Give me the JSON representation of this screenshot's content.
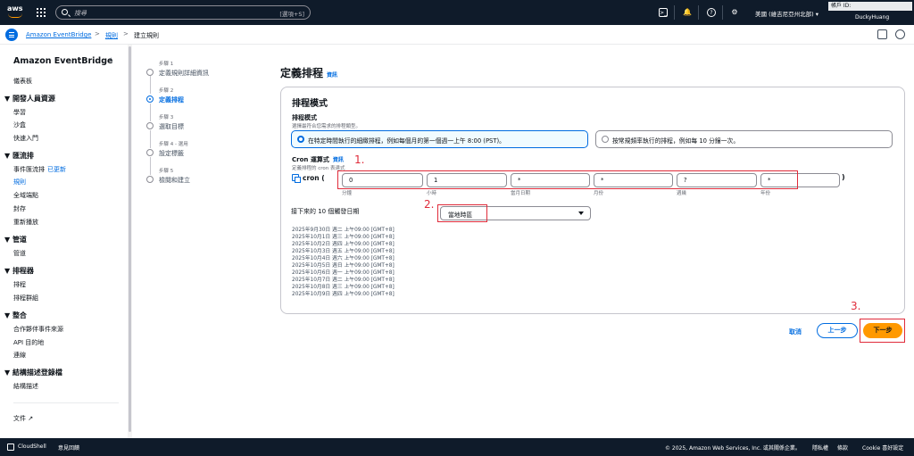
{
  "topnav": {
    "logo_text": "aws",
    "search_placeholder": "搜尋",
    "search_shortcut": "[選項+S]",
    "region": "美國 (維吉尼亞州北部) ▾",
    "account_label": "帳戶 ID:",
    "user": "DuckyHuang"
  },
  "breadcrumb": {
    "service": "Amazon EventBridge",
    "section": "規則",
    "current": "建立規則",
    "sep": ">"
  },
  "sidebar": {
    "title": "Amazon EventBridge",
    "close": "‹",
    "dashboard": "儀表板",
    "dev_resources": "▼ 開發人員資源",
    "learn": "學習",
    "sandbox": "沙盒",
    "quick_start": "快速入門",
    "buses": "▼ 匯流排",
    "event_bus": "事件匯流排",
    "new_badge": "已更新",
    "rules": "規則",
    "global_endpoints": "全域端點",
    "archive": "封存",
    "replay": "重新播放",
    "pipes_head": "▼ 管道",
    "pipes": "管道",
    "scheduler_head": "▼ 排程器",
    "schedules": "排程",
    "schedule_groups": "排程群組",
    "integration_head": "▼ 整合",
    "partner_sources": "合作夥伴事件來源",
    "api_destinations": "API 目的地",
    "connections": "連線",
    "schema_head": "▼ 結構描述登錄檔",
    "schemas": "結構描述",
    "docs": "文件 ↗"
  },
  "steps": [
    {
      "label": "步驟 1",
      "title": "定義規則詳細資訊"
    },
    {
      "label": "步驟 2",
      "title": "定義排程"
    },
    {
      "label": "步驟 3",
      "title": "選取目標"
    },
    {
      "label": "步驟 4 - 選用",
      "title": "設定標籤"
    },
    {
      "label": "步驟 5",
      "title": "檢閱和建立"
    }
  ],
  "main": {
    "page_title": "定義排程",
    "info": "資訊",
    "panel_title": "排程模式",
    "pattern_label": "排程模式",
    "pattern_desc": "選擇最符合您需求的排程類型。",
    "option_fine": "在特定時間執行的細緻排程，例如每個月的第一個週一上午 8:00 (PST)。",
    "option_rate": "按常規頻率執行的排程，例如每 10 分鐘一次。",
    "cron_label": "Cron 運算式",
    "cron_desc": "定義排程的 cron 表達式",
    "cron_prefix": "cron (",
    "cron_suffix": ")",
    "cron_fields": [
      {
        "value": "0",
        "caption": "分鐘"
      },
      {
        "value": "1",
        "caption": "小時"
      },
      {
        "value": "*",
        "caption": "當月日期"
      },
      {
        "value": "*",
        "caption": "月份"
      },
      {
        "value": "?",
        "caption": "週幾"
      },
      {
        "value": "*",
        "caption": "年份"
      }
    ],
    "next_dates_label": "接下來的 10 個觸發日期",
    "timezone": "當地時區",
    "dates": [
      "2025年9月30日 週二 上午09:00 [GMT+8]",
      "2025年10月1日 週三 上午09:00 [GMT+8]",
      "2025年10月2日 週四 上午09:00 [GMT+8]",
      "2025年10月3日 週五 上午09:00 [GMT+8]",
      "2025年10月4日 週六 上午09:00 [GMT+8]",
      "2025年10月5日 週日 上午09:00 [GMT+8]",
      "2025年10月6日 週一 上午09:00 [GMT+8]",
      "2025年10月7日 週二 上午09:00 [GMT+8]",
      "2025年10月8日 週三 上午09:00 [GMT+8]",
      "2025年10月9日 週四 上午09:00 [GMT+8]"
    ],
    "cancel": "取消",
    "previous": "上一步",
    "next": "下一步"
  },
  "annotations": [
    "1.",
    "2.",
    "3."
  ],
  "footer": {
    "cloudshell": "CloudShell",
    "feedback": "意見回饋",
    "copyright": "© 2025, Amazon Web Services, Inc. 或其關係企業。",
    "privacy": "隱私權",
    "terms": "條款",
    "cookie": "Cookie 喜好設定"
  },
  "colors": {
    "accent": "#006ce0",
    "primary_button": "#ff9900",
    "annotation": "#e02b3a",
    "nav": "#0f1b2a"
  }
}
